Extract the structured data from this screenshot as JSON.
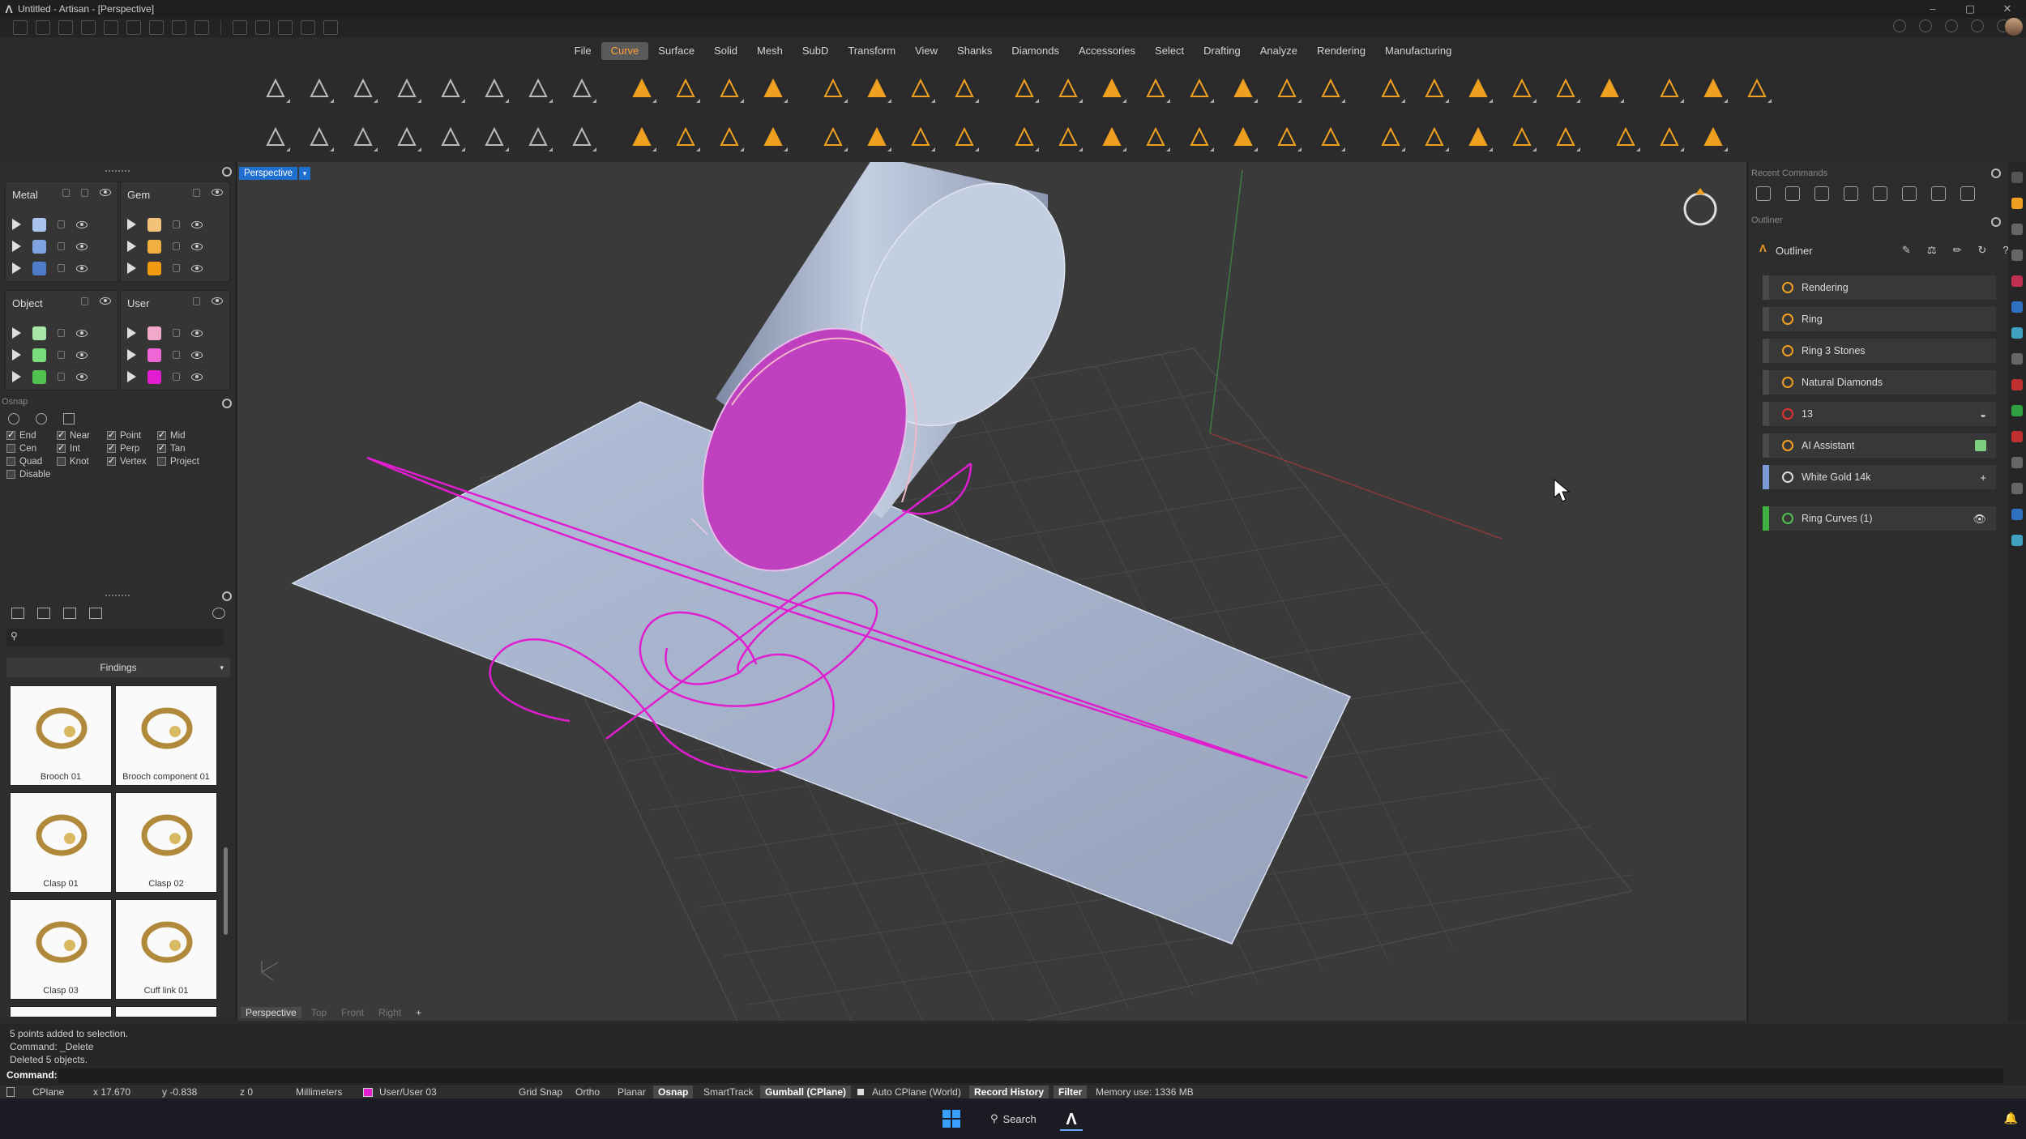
{
  "window": {
    "title": "Untitled - Artisan - [Perspective]"
  },
  "menu": [
    "File",
    "Curve",
    "Surface",
    "Solid",
    "Mesh",
    "SubD",
    "Transform",
    "View",
    "Shanks",
    "Diamonds",
    "Accessories",
    "Select",
    "Drafting",
    "Analyze",
    "Rendering",
    "Manufacturing"
  ],
  "menu_active": "Curve",
  "layers": {
    "metal": {
      "title": "Metal",
      "colors": [
        "#a9c4ee",
        "#7fa3de",
        "#4f7cc9"
      ]
    },
    "gem": {
      "title": "Gem",
      "colors": [
        "#f2c27a",
        "#f0b040",
        "#f09a10"
      ]
    },
    "object": {
      "title": "Object",
      "colors": [
        "#a6e6a6",
        "#7bdc7b",
        "#4fc24f"
      ]
    },
    "user": {
      "title": "User",
      "colors": [
        "#f2a8c8",
        "#ee66d8",
        "#e01ed0"
      ]
    }
  },
  "osnap": {
    "title": "Osnap",
    "items": [
      {
        "label": "End",
        "on": true
      },
      {
        "label": "Near",
        "on": true
      },
      {
        "label": "Point",
        "on": true
      },
      {
        "label": "Mid",
        "on": true
      },
      {
        "label": "Cen",
        "on": false
      },
      {
        "label": "Int",
        "on": true
      },
      {
        "label": "Perp",
        "on": true
      },
      {
        "label": "Tan",
        "on": true
      },
      {
        "label": "Quad",
        "on": false
      },
      {
        "label": "Knot",
        "on": false
      },
      {
        "label": "Vertex",
        "on": true
      },
      {
        "label": "Project",
        "on": false
      },
      {
        "label": "Disable",
        "on": false
      }
    ]
  },
  "library": {
    "category": "Findings",
    "items": [
      "Brooch 01",
      "Brooch component 01",
      "Clasp 01",
      "Clasp 02",
      "Clasp 03",
      "Cuff link 01"
    ]
  },
  "viewport": {
    "label": "Perspective",
    "tabs": [
      "Perspective",
      "Top",
      "Front",
      "Right"
    ],
    "add_tab": "+"
  },
  "right_panel": {
    "recent_title": "Recent Commands",
    "outliner_title": "Outliner",
    "outliner_label": "Outliner",
    "items": [
      {
        "label": "Rendering",
        "icon_color": "#f0a020"
      },
      {
        "label": "Ring",
        "icon_color": "#f0a020"
      },
      {
        "label": "Ring 3 Stones",
        "icon_color": "#f0a020"
      },
      {
        "label": "Natural Diamonds",
        "icon_color": "#f0a020"
      },
      {
        "label": "13",
        "icon_color": "#e03030"
      },
      {
        "label": "AI Assistant",
        "icon_color": "#f0a020"
      },
      {
        "label": "White Gold 14k",
        "icon_color": "#dddddd"
      },
      {
        "label": "Ring Curves (1)",
        "icon_color": "#50c050"
      }
    ]
  },
  "command": {
    "history": [
      "5 points added to selection.",
      "Command: _Delete",
      "Deleted 5 objects."
    ],
    "prompt": "Command:"
  },
  "status": {
    "cplane": "CPlane",
    "x": "x 17.670",
    "y": "y -0.838",
    "z": "z 0",
    "units": "Millimeters",
    "layer": "User/User 03",
    "layer_color": "#e01ed0",
    "grid_snap": "Grid Snap",
    "ortho": "Ortho",
    "planar": "Planar",
    "osnap": "Osnap",
    "smarttrack": "SmartTrack",
    "gumball": "Gumball (CPlane)",
    "auto_cplane": "Auto CPlane (World)",
    "record_history": "Record History",
    "filter": "Filter",
    "memory": "Memory use: 1336 MB"
  },
  "taskbar": {
    "search": "Search"
  }
}
